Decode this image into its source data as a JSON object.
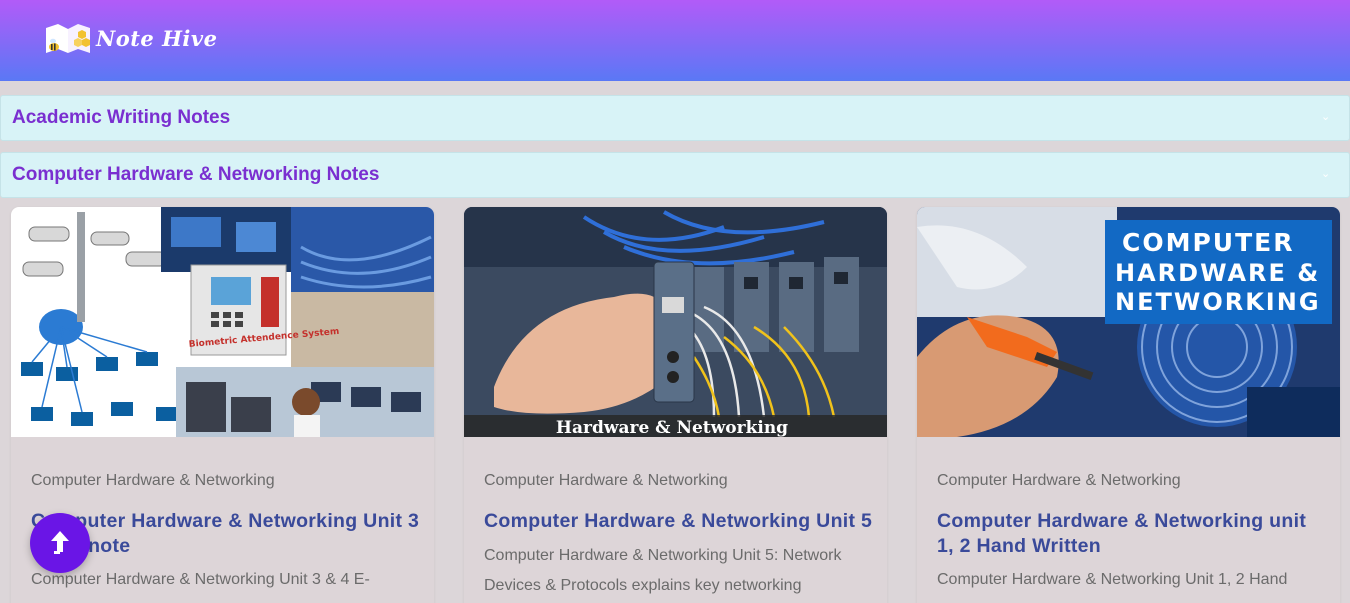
{
  "header": {
    "logo_text": "Note Hive"
  },
  "sections": [
    {
      "title": "Academic Writing Notes"
    },
    {
      "title": "Computer Hardware & Networking Notes"
    }
  ],
  "cards": [
    {
      "category": "Computer Hardware & Networking",
      "title": "Computer Hardware & Networking Unit 3 & 4 E-note",
      "description": "Computer Hardware & Networking Unit 3 & 4 E-",
      "image_text": [
        "Biometric Attendence System"
      ]
    },
    {
      "category": "Computer Hardware & Networking",
      "title": "Computer Hardware & Networking Unit 5",
      "description": "Computer Hardware & Networking Unit 5: Network Devices & Protocols explains key networking",
      "image_text": [
        "Hardware & Networking"
      ]
    },
    {
      "category": "Computer Hardware & Networking",
      "title": "Computer Hardware & Networking unit 1, 2 Hand Written",
      "description": "Computer Hardware & Networking Unit 1, 2 Hand",
      "image_text": [
        "COMPUTER",
        "HARDWARE &",
        "NETWORKING"
      ]
    }
  ],
  "icons": {
    "logo": "book-bee-icon",
    "accordion_toggle": "chevron-down-icon",
    "scroll_top": "arrow-up-icon"
  },
  "colors": {
    "header_gradient_top": "#b25bf8",
    "header_gradient_bottom": "#5a78f5",
    "section_title": "#7a2fd0",
    "card_title": "#3a4a9a",
    "scroll_button": "#6a15e6"
  }
}
